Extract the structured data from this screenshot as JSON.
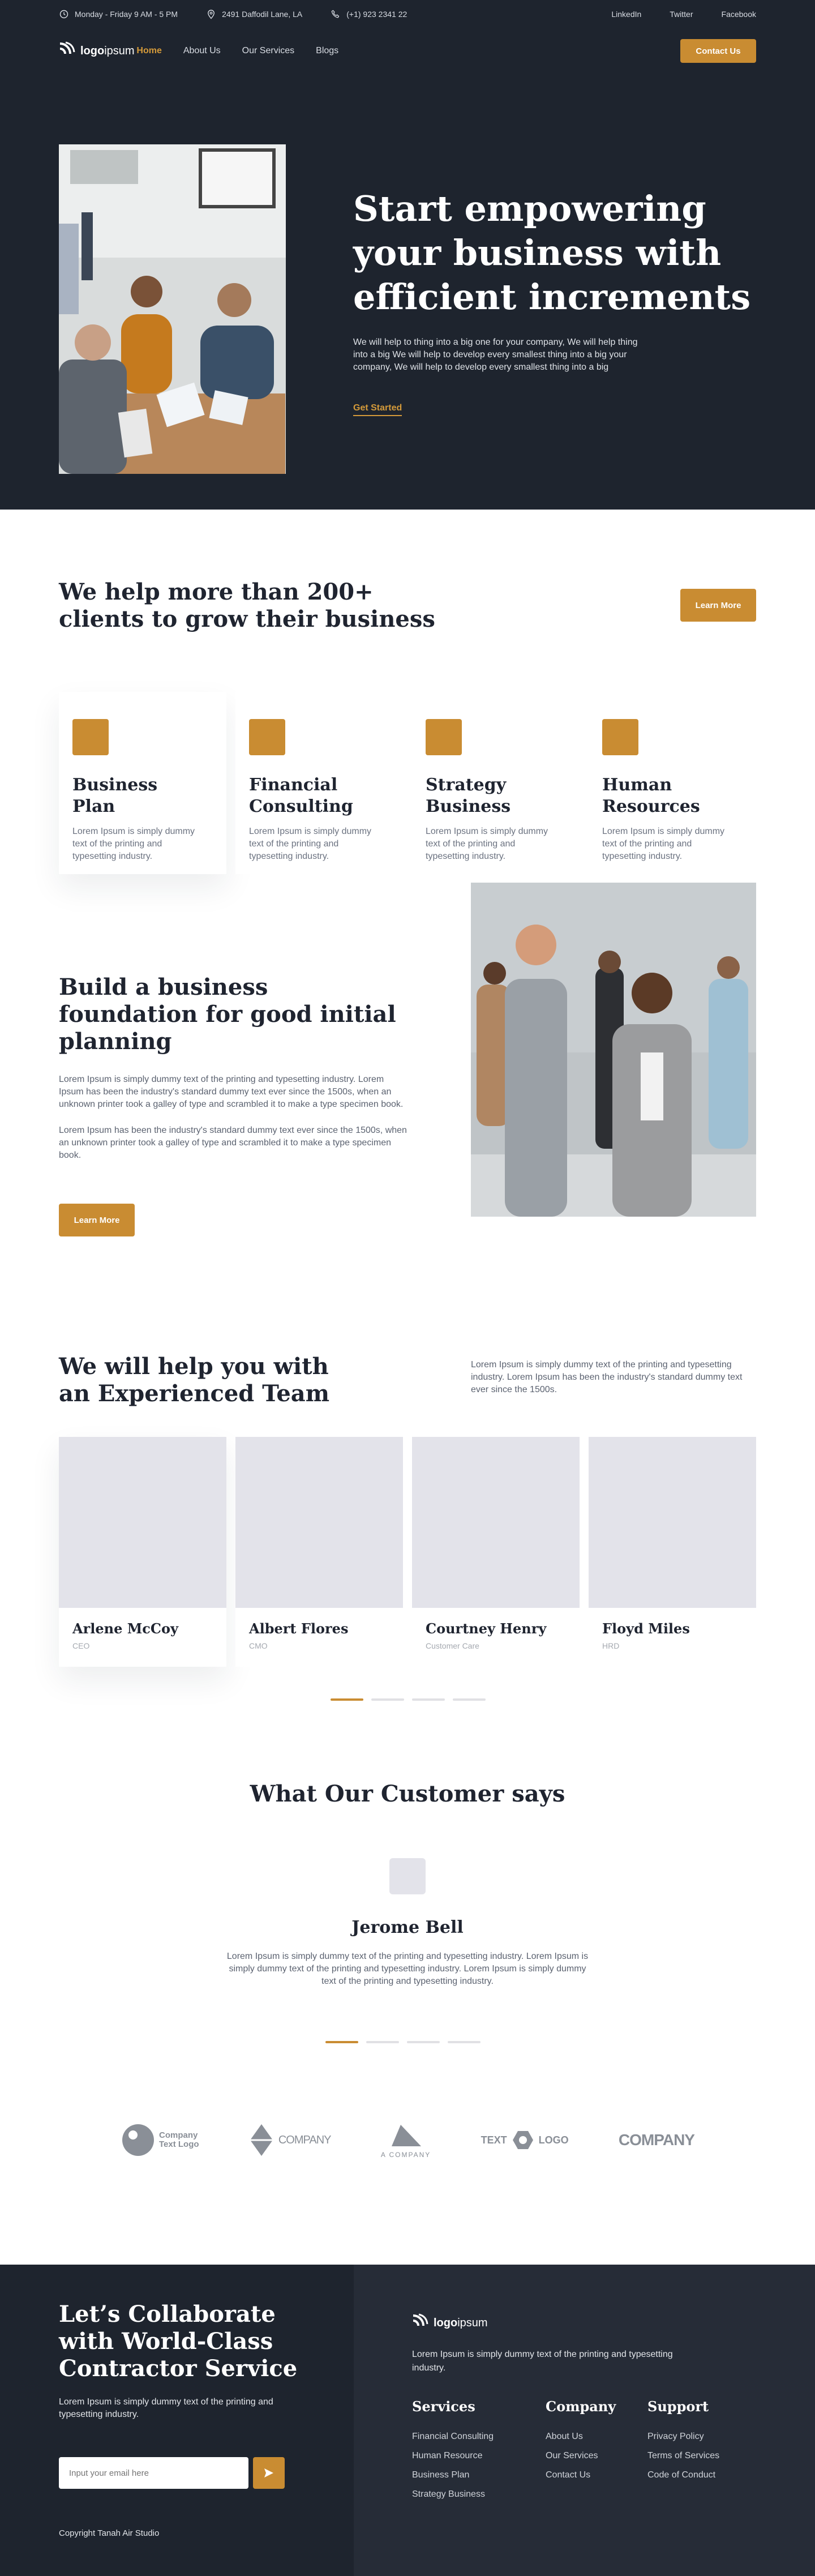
{
  "topbar": {
    "hours": "Monday - Friday 9 AM - 5 PM",
    "address": "2491  Daffodil Lane, LA",
    "phone": "(+1) 923 2341 22",
    "social": [
      "LinkedIn",
      "Twitter",
      "Facebook"
    ]
  },
  "nav": {
    "logo_bold": "logo",
    "logo_light": "ipsum",
    "items": [
      "Home",
      "About Us",
      "Our Services",
      "Blogs"
    ],
    "active_item": "Home",
    "contact_label": "Contact Us"
  },
  "hero": {
    "title": "Start empowering your business with efficient increments",
    "body": "We will help to thing into a big one for your company, We will help thing into a big We will help to develop every smallest thing into a big  your company, We will help to develop every smallest thing into a big",
    "cta": "Get Started"
  },
  "clients": {
    "title": "We help more than 200+ clients to grow their business",
    "button": "Learn More",
    "cards": [
      {
        "title": "Business Plan",
        "text": "Lorem Ipsum is simply dummy text of the printing and typesetting industry."
      },
      {
        "title": "Financial Consulting",
        "text": "Lorem Ipsum is simply dummy text of the printing and typesetting industry."
      },
      {
        "title": "Strategy Business",
        "text": "Lorem Ipsum is simply dummy text of the printing and typesetting industry."
      },
      {
        "title": "Human Resources",
        "text": "Lorem Ipsum is simply dummy text of the printing and typesetting industry."
      }
    ]
  },
  "foundation": {
    "title": "Build a business foundation for good initial planning",
    "p1": "Lorem Ipsum is simply dummy text of the printing and typesetting industry. Lorem Ipsum has been the industry's standard dummy text ever since the 1500s, when an unknown printer took a galley of type and scrambled it to make a type specimen book.",
    "p2": "Lorem Ipsum has been the industry's standard dummy text ever since the 1500s, when an unknown printer took a galley of type and scrambled it to make a type specimen book.",
    "button": "Learn More"
  },
  "team": {
    "title": "We will help you with an Experienced Team",
    "intro": "Lorem Ipsum is simply dummy text of the printing and typesetting industry. Lorem Ipsum has been the industry's standard dummy text ever since the 1500s.",
    "members": [
      {
        "name": "Arlene McCoy",
        "role": "CEO"
      },
      {
        "name": "Albert Flores",
        "role": "CMO"
      },
      {
        "name": "Courtney Henry",
        "role": "Customer Care"
      },
      {
        "name": "Floyd Miles",
        "role": "HRD"
      }
    ]
  },
  "testimonials": {
    "title": "What Our Customer says",
    "name": "Jerome Bell",
    "quote": "Lorem Ipsum is simply dummy text of the printing and typesetting industry. Lorem Ipsum is simply dummy text of the printing and typesetting industry. Lorem Ipsum is simply dummy text of the printing and typesetting industry."
  },
  "logos": {
    "company_text": "Company",
    "text_logo": "Text Logo",
    "company_caps": "COMPANY",
    "a_company": "A COMPANY",
    "text_logo_caps_1": "TEXT",
    "text_logo_caps_2": "LOGO",
    "company_bold": "COMPANY"
  },
  "footer": {
    "title": "Let’s Collaborate with World-Class Contractor Service",
    "text": "Lorem Ipsum is simply dummy text of the printing and typesetting industry.",
    "email_placeholder": "Input your email here",
    "copyright": "Copyright Tanah Air Studio",
    "logo_bold": "logo",
    "logo_light": "ipsum",
    "desc": "Lorem Ipsum is simply dummy text of the printing and typesetting industry.",
    "columns": [
      {
        "title": "Services",
        "links": [
          "Financial Consulting",
          "Human Resource",
          "Business Plan",
          "Strategy Business"
        ]
      },
      {
        "title": "Company",
        "links": [
          "About Us",
          "Our Services",
          "Contact Us"
        ]
      },
      {
        "title": "Support",
        "links": [
          "Privacy Policy",
          "Terms of Services",
          "Code of Conduct"
        ]
      }
    ]
  },
  "colors": {
    "dark": "#1e242e",
    "footer_right": "#262c37",
    "accent": "#c98c32",
    "placeholder": "#e3e3ea"
  }
}
